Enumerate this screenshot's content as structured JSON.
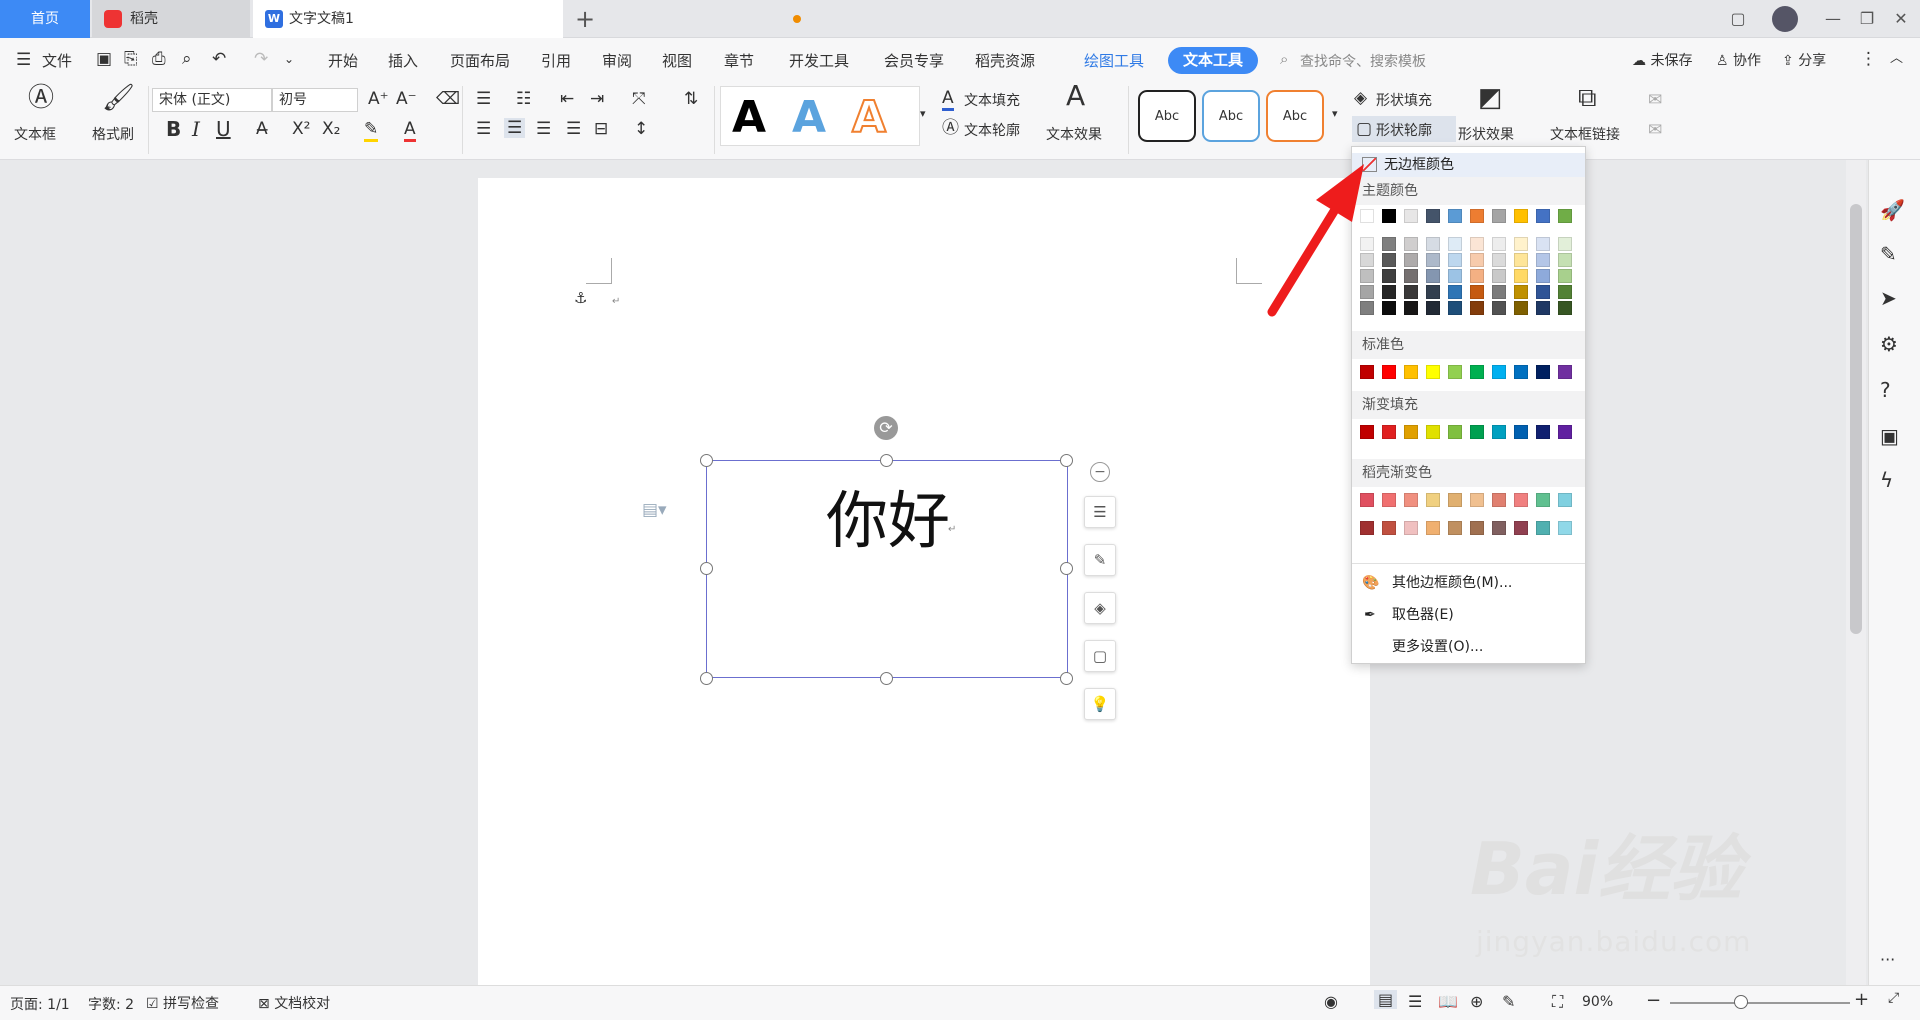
{
  "tabs": {
    "home": "首页",
    "daoke": "稻壳",
    "doc": "文字文稿1"
  },
  "menu": {
    "file": "文件",
    "items": [
      "开始",
      "插入",
      "页面布局",
      "引用",
      "审阅",
      "视图",
      "章节",
      "开发工具",
      "会员专享",
      "稻壳资源"
    ],
    "drawing_tools": "绘图工具",
    "text_tools": "文本工具",
    "search": "查找命令、搜索模板",
    "unsaved": "未保存",
    "collab": "协作",
    "share": "分享"
  },
  "ribbon": {
    "textbox": "文本框",
    "format_painter": "格式刷",
    "font": "宋体 (正文)",
    "size": "初号",
    "text_fill": "文本填充",
    "text_outline": "文本轮廓",
    "text_effect": "文本效果",
    "shape_fill": "形状填充",
    "shape_outline": "形状轮廓",
    "shape_effect": "形状效果",
    "textbox_link": "文本框链接",
    "abc": "Abc",
    "bold": "B",
    "italic": "I",
    "underline": "U",
    "superscript": "X²",
    "subscript": "X₂"
  },
  "document": {
    "text": "你好",
    "return_mark": "↵"
  },
  "dropdown": {
    "no_border": "无边框颜色",
    "theme": "主题颜色",
    "standard": "标准色",
    "gradient": "渐变填充",
    "daoke_gradient": "稻壳渐变色",
    "other": "其他边框颜色(M)...",
    "picker": "取色器(E)",
    "more": "更多设置(O)..."
  },
  "theme_top": [
    "#ffffff",
    "#000000",
    "#e7e6e6",
    "#44546a",
    "#5b9bd5",
    "#ed7d31",
    "#a5a5a5",
    "#ffc000",
    "#4472c4",
    "#70ad47"
  ],
  "theme_shades": [
    [
      "#f2f2f2",
      "#7f7f7f",
      "#d0cece",
      "#d6dce4",
      "#deebf6",
      "#fbe5d5",
      "#ededed",
      "#fff2cc",
      "#d9e2f3",
      "#e2efd9"
    ],
    [
      "#d8d8d8",
      "#595959",
      "#aeabab",
      "#adb9ca",
      "#bdd7ee",
      "#f7cbac",
      "#dbdbdb",
      "#fee599",
      "#b4c6e7",
      "#c5e0b3"
    ],
    [
      "#bfbfbf",
      "#3f3f3f",
      "#757070",
      "#8496b0",
      "#9cc3e5",
      "#f4b083",
      "#c9c9c9",
      "#ffd965",
      "#8eaadb",
      "#a8d08d"
    ],
    [
      "#a5a5a5",
      "#262626",
      "#3a3838",
      "#323f4f",
      "#2e75b5",
      "#c55a11",
      "#7b7b7b",
      "#bf9000",
      "#2f5496",
      "#538135"
    ],
    [
      "#7f7f7f",
      "#0c0c0c",
      "#171616",
      "#222a35",
      "#1e4e79",
      "#833c0b",
      "#525252",
      "#7f6000",
      "#1f3864",
      "#375623"
    ]
  ],
  "standard_colors": [
    "#c00000",
    "#ff0000",
    "#ffc000",
    "#ffff00",
    "#92d050",
    "#00b050",
    "#00b0f0",
    "#0070c0",
    "#002060",
    "#7030a0"
  ],
  "gradient_colors": [
    "#c00000",
    "#e02020",
    "#e0a000",
    "#e0e000",
    "#80c040",
    "#00a050",
    "#00a0c0",
    "#0060b0",
    "#102070",
    "#6020a0"
  ],
  "daoke_row1": [
    "#e05060",
    "#f07070",
    "#f09080",
    "#f0d080",
    "#e0b070",
    "#f0c090",
    "#e08070",
    "#f08080",
    "#60c090",
    "#80d0e0"
  ],
  "daoke_row2": [
    "#a03030",
    "#c05040",
    "#f0c0c0",
    "#f0b070",
    "#c09060",
    "#a07050",
    "#806060",
    "#904050",
    "#50b0b0",
    "#90d8e8"
  ],
  "status": {
    "page": "页面: 1/1",
    "words": "字数: 2",
    "spell": "拼写检查",
    "proof": "文档校对",
    "zoom": "90%"
  },
  "watermark": {
    "brand": "Bai经验",
    "url": "jingyan.baidu.com"
  }
}
